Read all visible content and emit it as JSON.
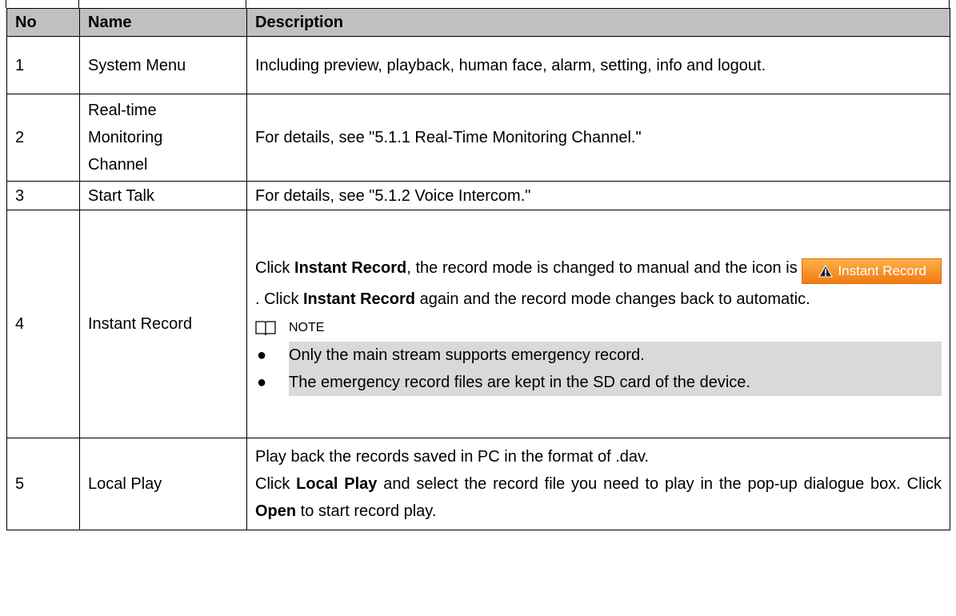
{
  "table": {
    "headers": {
      "no": "No",
      "name": "Name",
      "description": "Description"
    },
    "rows": [
      {
        "no": "1",
        "name": "System Menu",
        "description": "Including preview, playback, human face, alarm, setting, info and logout."
      },
      {
        "no": "2",
        "name_lines": [
          "Real-time",
          "Monitoring",
          "Channel"
        ],
        "description": "For details, see \"5.1.1 Real-Time Monitoring Channel.\""
      },
      {
        "no": "3",
        "name": "Start Talk",
        "description": "For details, see \"5.1.2 Voice Intercom.\""
      },
      {
        "no": "4",
        "name": "Instant Record",
        "desc_parts": {
          "click": "Click ",
          "bold1": "Instant Record",
          "mid1": ", the record mode is changed to manual and the icon is ",
          "button_label": "Instant Record",
          "mid2": ". Click ",
          "bold2": "Instant Record",
          "end": " again and the record mode changes back to automatic."
        },
        "note_label": "NOTE",
        "note_icon": "book-icon",
        "bullets": [
          "Only the main stream supports emergency record.",
          "The emergency record files are kept in the SD card of the device."
        ]
      },
      {
        "no": "5",
        "name": "Local Play",
        "line1": "Play back the records saved in PC in the format of .dav.",
        "desc_parts": {
          "click": "Click ",
          "bold1": "Local Play",
          "mid1": " and select the record file you need to play in the pop-up dialogue box. Click ",
          "bold2": "Open",
          "end": " to start record play."
        }
      }
    ]
  },
  "colors": {
    "header_bg": "#c0c0c0",
    "highlight_bg": "#d9d9d9",
    "button_orange": "#f07a10"
  }
}
